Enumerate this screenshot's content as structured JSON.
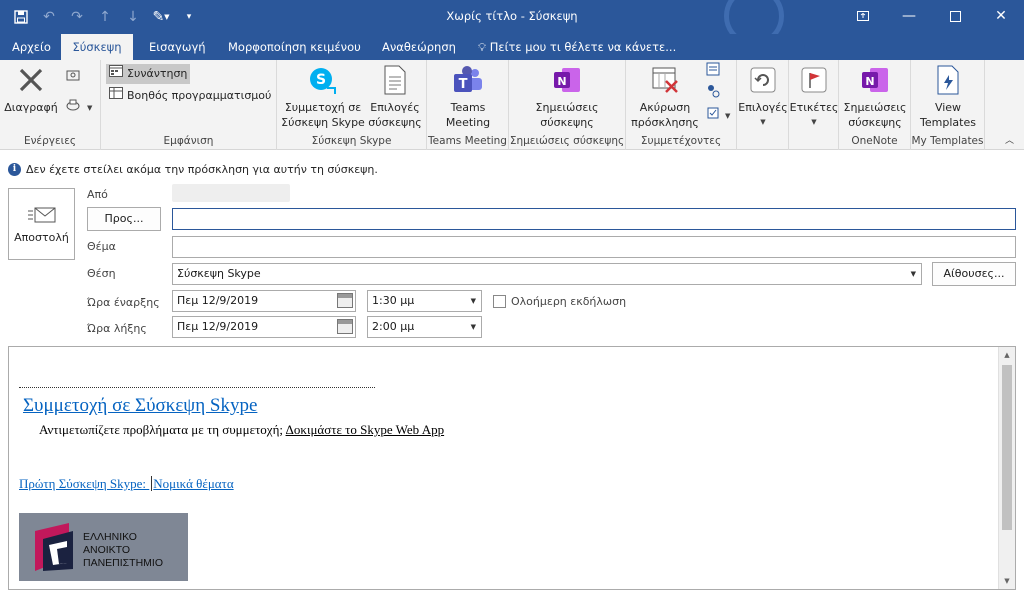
{
  "window": {
    "title": "Χωρίς τίτλο - Σύσκεψη"
  },
  "tabs": [
    {
      "label": "Αρχείο"
    },
    {
      "label": "Σύσκεψη"
    },
    {
      "label": "Εισαγωγή"
    },
    {
      "label": "Μορφοποίηση κειμένου"
    },
    {
      "label": "Αναθεώρηση"
    }
  ],
  "tell_me": "Πείτε μου τι θέλετε να κάνετε...",
  "ribbon": {
    "actions": {
      "delete": "Διαγραφή",
      "group": "Ενέργειες"
    },
    "show": {
      "appointment": "Συνάντηση",
      "scheduling": "Βοηθός προγραμματισμού",
      "group": "Εμφάνιση"
    },
    "skype": {
      "join": "Συμμετοχή σε Σύσκεψη Skype",
      "join_line1": "Συμμετοχή σε",
      "join_line2": "Σύσκεψη Skype",
      "options_line1": "Επιλογές",
      "options_line2": "σύσκεψης",
      "group": "Σύσκεψη Skype"
    },
    "teams": {
      "line1": "Teams",
      "line2": "Meeting",
      "group": "Teams Meeting"
    },
    "notes": {
      "line1": "Σημειώσεις",
      "line2": "σύσκεψης",
      "group": "Σημειώσεις σύσκεψης"
    },
    "attendees": {
      "cancel_line1": "Ακύρωση",
      "cancel_line2": "πρόσκλησης",
      "group": "Συμμετέχοντες"
    },
    "options": {
      "label": "Επιλογές"
    },
    "tags": {
      "label": "Ετικέτες"
    },
    "onenote": {
      "line1": "Σημειώσεις",
      "line2": "σύσκεψης",
      "group": "OneNote"
    },
    "templates": {
      "line1": "View",
      "line2": "Templates",
      "group": "My Templates"
    }
  },
  "infobar": "Δεν έχετε στείλει ακόμα την πρόσκληση για αυτήν τη σύσκεψη.",
  "form": {
    "send": "Αποστολή",
    "from_label": "Από",
    "to_button": "Προς...",
    "to_value": "",
    "subject_label": "Θέμα",
    "subject_value": "",
    "location_label": "Θέση",
    "location_value": "Σύσκεψη Skype",
    "rooms_button": "Αίθουσες...",
    "start_label": "Ώρα έναρξης",
    "start_date": "Πεμ 12/9/2019",
    "start_time": "1:30 μμ",
    "allday_label": "Ολοήμερη εκδήλωση",
    "end_label": "Ώρα λήξης",
    "end_date": "Πεμ 12/9/2019",
    "end_time": "2:00 μμ"
  },
  "body": {
    "join_link": "Συμμετοχή σε Σύσκεψη Skype",
    "trouble_text": "Αντιμετωπίζετε προβλήματα με τη συμμετοχή;",
    "trouble_link": "Δοκιμάστε το Skype Web App",
    "first_meeting": "Πρώτη Σύσκεψη Skype:",
    "legal": "Νομικά θέματα",
    "logo_lines": [
      "ΕΛΛΗΝΙΚΟ",
      "ΑΝΟΙΚΤΟ",
      "ΠΑΝΕΠΙΣΤΗΜΙΟ"
    ]
  },
  "colors": {
    "accent": "#2b579a",
    "link": "#0563c1",
    "skype": "#00aff0",
    "teams": "#5558af",
    "onenote": "#7719aa"
  }
}
